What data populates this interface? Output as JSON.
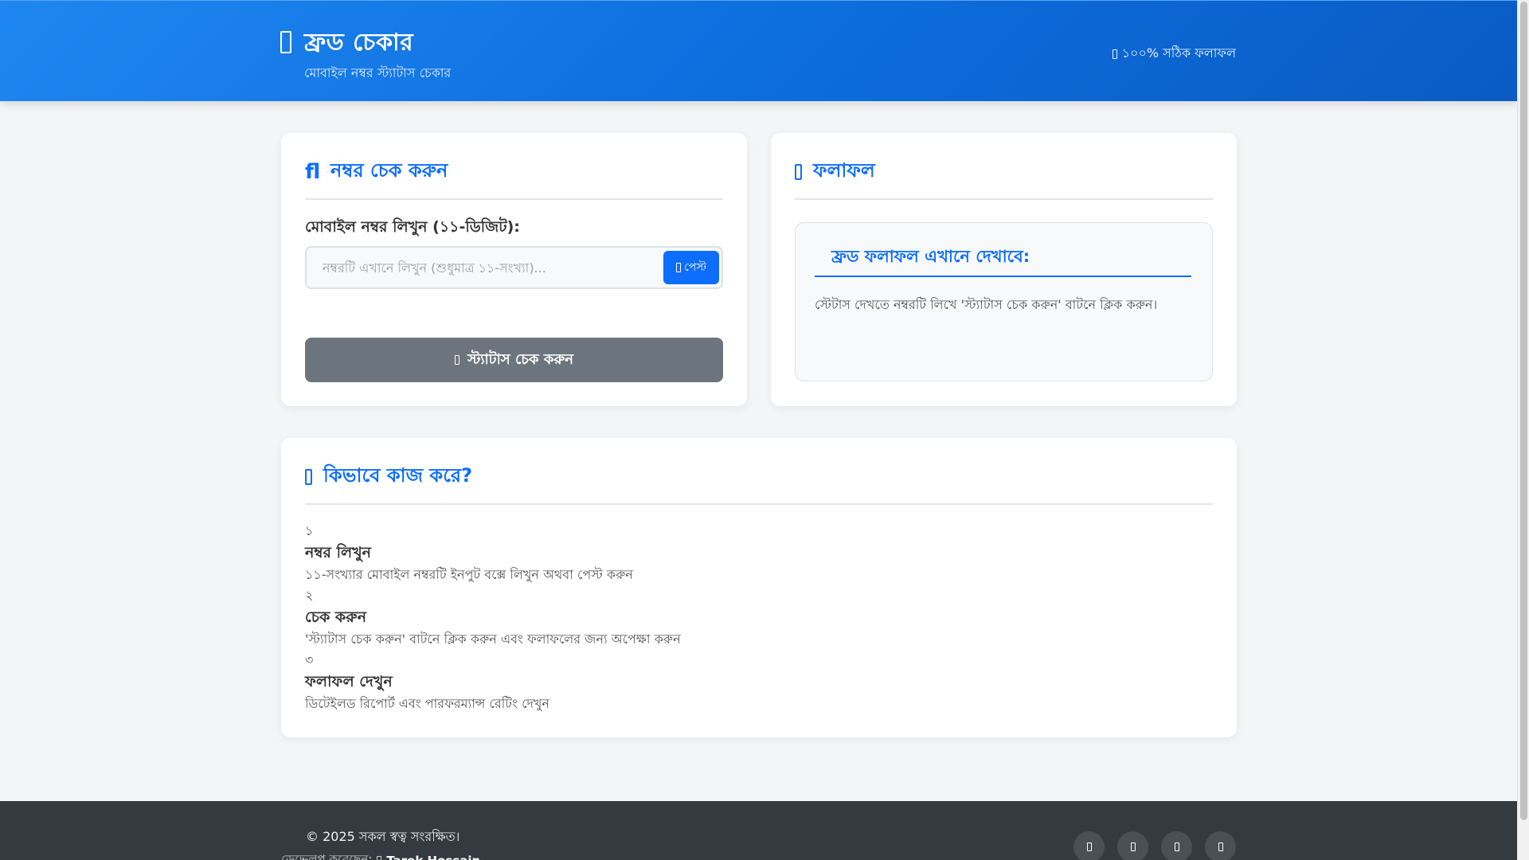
{
  "header": {
    "title": "ফ্রড চেকার",
    "subtitle": "মোবাইল নম্বর স্ট্যাটাস চেকার",
    "tagline": "১০০% সঠিক ফলাফল",
    "brand_icon": "shield-icon",
    "colors": {
      "primary": "#0d6efd",
      "gradient_start": "#1f87f0",
      "gradient_end": "#0a5bc4"
    }
  },
  "check_card": {
    "title": "নম্বর চেক করুন",
    "title_icon": "fl",
    "field_label": "মোবাইল নম্বর লিখুন (১১-ডিজিট):",
    "input_value": "",
    "input_placeholder": "নম্বরটি এখানে লিখুন (শুধুমাত্র ১১-সংখ্যা)...",
    "paste_label": "পেস্ট",
    "check_button_label": "স্ট্যাটাস চেক করুন",
    "check_button_color": "#6c757d"
  },
  "result_card": {
    "title": "ফলাফল",
    "result_heading": "ফ্রড ফলাফল এখানে দেখাবে:",
    "result_text": "স্টেটাস দেখতে নম্বরটি লিখে 'স্ট্যাটাস চেক করুন' বাটনে ক্লিক করুন।"
  },
  "how_card": {
    "title": "কিভাবে কাজ করে?",
    "steps": [
      {
        "num": "১",
        "title": "নম্বর লিখুন",
        "desc": "১১-সংখ্যার মোবাইল নম্বরটি ইনপুট বক্সে লিখুন অথবা পেস্ট করুন"
      },
      {
        "num": "২",
        "title": "চেক করুন",
        "desc": "'স্ট্যাটাস চেক করুন' বাটনে ক্লিক করুন এবং ফলাফলের জন্য অপেক্ষা করুন"
      },
      {
        "num": "৩",
        "title": "ফলাফল দেখুন",
        "desc": "ডিটেইলড রিপোর্ট এবং পারফরম্যান্স রেটিং দেখুন"
      }
    ]
  },
  "footer": {
    "copyright": "© 2025 সকল স্বত্ব সংরক্ষিত।",
    "developer_prefix": "ডেভেলপ করেছেন:",
    "developer_name": "Tarek Hossain",
    "socials": [
      "facebook-icon",
      "telegram-icon",
      "whatsapp-icon",
      "github-icon"
    ],
    "background": "#343a40"
  }
}
